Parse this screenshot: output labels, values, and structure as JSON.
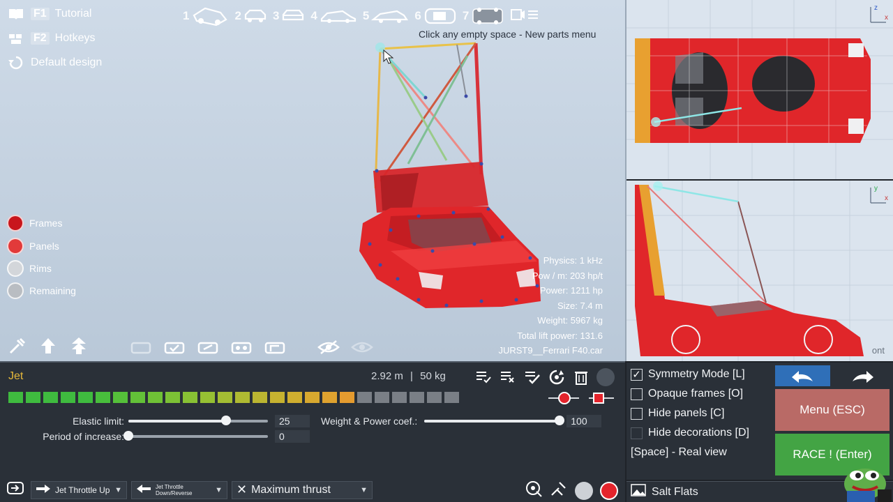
{
  "top_menu": {
    "tutorial": {
      "key": "F1",
      "label": "Tutorial"
    },
    "hotkeys": {
      "key": "F2",
      "label": "Hotkeys"
    },
    "default_design": {
      "label": "Default design"
    }
  },
  "view_tabs": [
    "1",
    "2",
    "3",
    "4",
    "5",
    "6",
    "7"
  ],
  "hint": "Click any empty space - New parts menu",
  "legend": [
    "Frames",
    "Panels",
    "Rims",
    "Remaining"
  ],
  "legend_colors": [
    "#c8161c",
    "#e23a3a",
    "#d3d6da",
    "#b9bdc2"
  ],
  "stats": {
    "physics": "Physics: 1 kHz",
    "pow_m": "Pow / m: 203 hp/t",
    "power": "Power: 1211 hp",
    "size": "Size: 7.4 m",
    "weight": "Weight: 5967 kg",
    "lift": "Total lift power: 131.6",
    "file": "JURST9__Ferrari F40.car"
  },
  "ortho": {
    "side_label": "ont"
  },
  "part": {
    "name": "Jet",
    "length": "2.92 m",
    "separator": "|",
    "mass": "50 kg",
    "health_level": 0.77,
    "health_colors": [
      "#3fbb3f",
      "#3fbb3f",
      "#3fbb3f",
      "#3fbb3f",
      "#3fbb3f",
      "#48be3c",
      "#55c03a",
      "#63c138",
      "#6fc136",
      "#7cc135",
      "#88c134",
      "#96c033",
      "#a3bd33",
      "#afba32",
      "#bbb531",
      "#c6b230",
      "#cfae2f",
      "#d7a82f",
      "#dfa22f",
      "#e59b2f",
      "#7a7f86",
      "#7a7f86",
      "#7a7f86",
      "#7a7f86",
      "#7a7f86",
      "#7a7f86"
    ]
  },
  "sliders": {
    "elastic_label": "Elastic limit:",
    "elastic_value": "25",
    "elastic_level": 0.7,
    "period_label": "Period of increase:",
    "period_value": "0",
    "period_level": 0.0,
    "weight_label": "Weight & Power coef.:",
    "weight_value": "100",
    "weight_level": 1.0
  },
  "controls": {
    "throttle_up": "Jet Throttle Up",
    "throttle_down_1": "Jet Throttle",
    "throttle_down_2": "Down/Reverse",
    "thrust": "Maximum thrust"
  },
  "options": [
    {
      "label": "Symmetry Mode [L]",
      "checked": true
    },
    {
      "label": "Opaque frames [O]",
      "checked": false
    },
    {
      "label": "Hide panels [C]",
      "checked": false
    },
    {
      "label": "Hide decorations [D]",
      "checked": false
    }
  ],
  "real_view": "[Space] - Real view",
  "buttons": {
    "menu": "Menu (ESC)",
    "race": "RACE ! (Enter)"
  },
  "map": "Salt Flats",
  "colors": {
    "accent_blue": "#2f6fb8",
    "race_green": "#43a444",
    "menu_red": "#b96a66",
    "car_red": "#e0262a",
    "part_name": "#e7b93a"
  }
}
